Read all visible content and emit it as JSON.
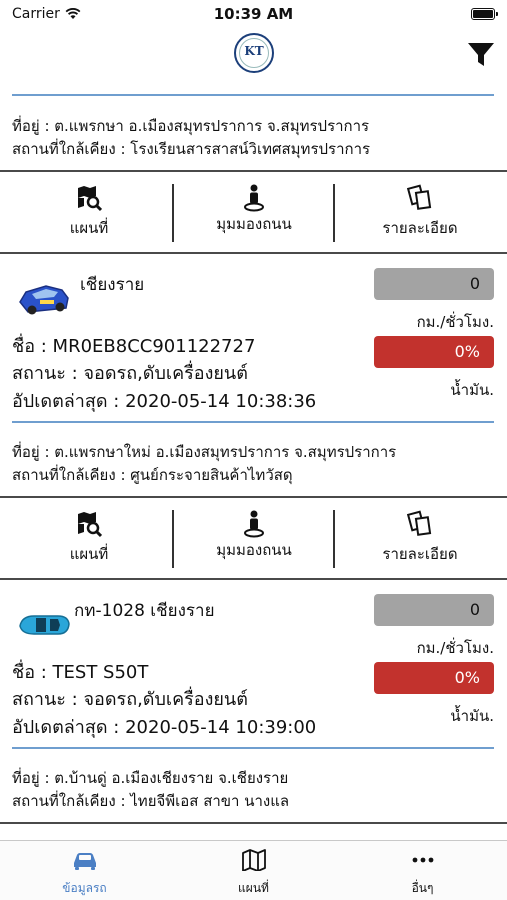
{
  "status_bar": {
    "carrier": "Carrier",
    "time": "10:39 AM"
  },
  "nav": {
    "logo_text": "KT"
  },
  "card_a": {
    "address": "ที่อยู่ : ต.แพรกษา อ.เมืองสมุทรปราการ จ.สมุทรปราการ",
    "nearby": "สถานที่ใกล้เคียง : โรงเรียนสารสาสน์วิเทศสมุทรปราการ"
  },
  "actions": {
    "map": "แผนที่",
    "street": "มุมมองถนน",
    "detail": "รายละเอียด"
  },
  "vehicles": [
    {
      "name": "เชียงราย",
      "speed": "0",
      "speed_unit": "กม./ชั่วโมง.",
      "fuel": "0%",
      "fuel_unit": "น้ำมัน.",
      "plate": "ชื่อ : MR0EB8CC901122727",
      "status": "สถานะ : จอดรถ,ดับเครื่องยนต์",
      "updated": "อัปเดตล่าสุด :  2020-05-14 10:38:36",
      "address": "ที่อยู่ : ต.แพรกษาใหม่ อ.เมืองสมุทรปราการ จ.สมุทรปราการ",
      "nearby": "สถานที่ใกล้เคียง : ศูนย์กระจายสินค้าไทวัสดุ",
      "car_color": "#2a52c9"
    },
    {
      "name": "กท-1028 เชียงราย",
      "speed": "0",
      "speed_unit": "กม./ชั่วโมง.",
      "fuel": "0%",
      "fuel_unit": "น้ำมัน.",
      "plate": "ชื่อ : TEST S50T",
      "status": "สถานะ : จอดรถ,ดับเครื่องยนต์",
      "updated": "อัปเดตล่าสุด :  2020-05-14 10:39:00",
      "address": "ที่อยู่ : ต.บ้านดู่ อ.เมืองเชียงราย จ.เชียงราย",
      "nearby": "สถานที่ใกล้เคียง : ไทยจีพีเอส สาขา นางแล",
      "car_color": "#2aa6d9"
    }
  ],
  "tabs": {
    "vehicle": "ข้อมูลรถ",
    "map": "แผนที่",
    "more": "อื่นๆ"
  },
  "colors": {
    "accent": "#4b7fc4",
    "fuel_red": "#c2322d",
    "speed_gray": "#a3a3a3",
    "divider_blue": "#6f9ecf"
  }
}
